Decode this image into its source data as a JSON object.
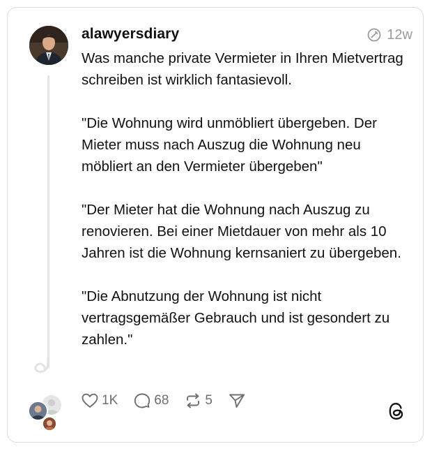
{
  "post": {
    "username": "alawyersdiary",
    "time": "12w",
    "paragraphs": [
      "Was manche private Vermieter in Ihren Mietvertrag schreiben ist wirklich fantasievoll.",
      "\"Die Wohnung wird unmöbliert übergeben. Der Mieter muss nach Auszug die Wohnung neu möbliert an den Vermieter übergeben\"",
      "\"Der Mieter hat die Wohnung nach Auszug zu renovieren. Bei einer Mietdauer von mehr als 10 Jahren ist die Wohnung kernsaniert zu übergeben.",
      "\"Die Abnutzung der Wohnung ist nicht vertragsgemäßer Gebrauch und ist gesondert zu zahlen.\""
    ]
  },
  "actions": {
    "likes": "1K",
    "replies": "68",
    "reposts": "5"
  },
  "icons": {
    "meta": "edited-circle-icon",
    "like": "heart-icon",
    "reply": "comment-bubble-icon",
    "repost": "repost-icon",
    "share": "send-icon",
    "brand": "threads-logo-icon"
  },
  "colors": {
    "text": "#111111",
    "muted": "#9a9a9a",
    "action": "#6f6f6f",
    "border": "#dcdcdc",
    "thread_line": "#e3e3e3"
  }
}
